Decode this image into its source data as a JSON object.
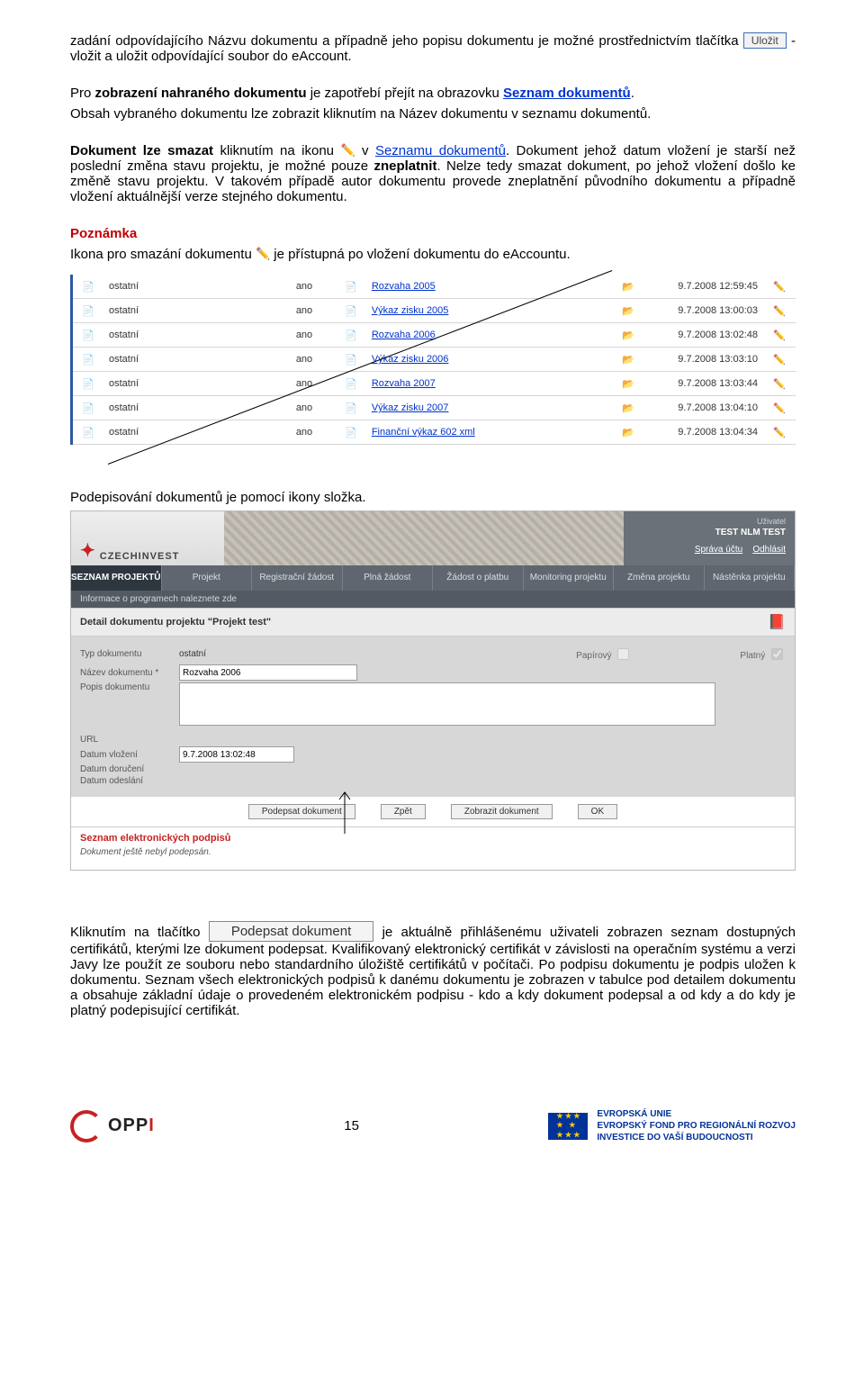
{
  "text": {
    "p1a": "zadání odpovídajícího Názvu dokumentu a případně jeho popisu dokumentu je možné prostřednictvím tlačítka ",
    "btn_ulozit": "Uložit",
    "p1b": " - vložit a uložit odpovídající soubor do eAccount.",
    "p2a": "Pro ",
    "p2b": "zobrazení nahraného dokumentu",
    "p2c": " je zapotřebí přejít na obrazovku ",
    "p2link": "Seznam dokumentů",
    "p2d": ".",
    "p3": "Obsah vybraného dokumentu lze zobrazit kliknutím na Název dokumentu v seznamu dokumentů.",
    "p4a": "Dokument lze smazat",
    "p4b": " kliknutím na ikonu ",
    "p4c": " v ",
    "p4link": "Seznamu dokumentů",
    "p4d": ". Dokument jehož datum vložení je starší než poslední změna stavu projektu, je možné pouze ",
    "p4e": "zneplatnit",
    "p4f": ". Nelze tedy smazat dokument, po jehož vložení došlo ke změně stavu projektu. V takovém případě autor dokumentu provede zneplatnění původního dokumentu a případně vložení aktuálnější verze stejného dokumentu.",
    "note_title": "Poznámka",
    "note_body_a": "Ikona pro smazání dokumentu ",
    "note_body_b": " je přístupná po vložení dokumentu do eAccountu.",
    "mid_text": "Podepisování dokumentů je pomocí ikony složka.",
    "p5a": "Kliknutím na tlačítko ",
    "btn_podepsat_long": "Podepsat dokument",
    "p5b": " je aktuálně přihlášenému uživateli zobrazen seznam dostupných certifikátů, kterými lze dokument podepsat. Kvalifikovaný elektronický certifikát v závislosti na operačním systému a verzi Javy lze použít ze souboru nebo standardního úložiště certifikátů v počítači. Po podpisu dokumentu je podpis uložen k dokumentu. Seznam všech elektronických podpisů k danému dokumentu je zobrazen v tabulce pod detailem dokumentu a obsahuje základní údaje o provedeném elektronickém podpisu - kdo a kdy dokument podepsal a od kdy a do kdy je platný podepisující certifikát.",
    "page_number": "15"
  },
  "table_rows": [
    {
      "type": "ostatní",
      "ano": "ano",
      "name": "Rozvaha 2005",
      "date": "9.7.2008 12:59:45"
    },
    {
      "type": "ostatní",
      "ano": "ano",
      "name": "Výkaz zisku 2005",
      "date": "9.7.2008 13:00:03"
    },
    {
      "type": "ostatní",
      "ano": "ano",
      "name": "Rozvaha 2006",
      "date": "9.7.2008 13:02:48"
    },
    {
      "type": "ostatní",
      "ano": "ano",
      "name": "Výkaz zisku 2006",
      "date": "9.7.2008 13:03:10"
    },
    {
      "type": "ostatní",
      "ano": "ano",
      "name": "Rozvaha 2007",
      "date": "9.7.2008 13:03:44"
    },
    {
      "type": "ostatní",
      "ano": "ano",
      "name": "Výkaz zisku 2007",
      "date": "9.7.2008 13:04:10"
    },
    {
      "type": "ostatní",
      "ano": "ano",
      "name": "Finanční výkaz 602 xml",
      "date": "9.7.2008 13:04:34"
    }
  ],
  "app": {
    "logo": "CZECHINVEST",
    "user_label": "Uživatel",
    "user_name": "TEST NLM TEST",
    "user_link1": "Správa účtu",
    "user_link2": "Odhlásit",
    "nav": [
      "SEZNAM PROJEKTŮ",
      "Projekt",
      "Registrační žádost",
      "Plná žádost",
      "Žádost o platbu",
      "Monitoring projektu",
      "Změna projektu",
      "Nástěnka projektu"
    ],
    "subnav": "Informace o programech naleznete zde",
    "panel": "Detail dokumentu projektu \"Projekt test\"",
    "form": {
      "typ_lbl": "Typ dokumentu",
      "typ_val": "ostatní",
      "nazev_lbl": "Název dokumentu *",
      "nazev_val": "Rozvaha 2006",
      "popis_lbl": "Popis dokumentu",
      "papirovy": "Papírový",
      "platny": "Platný",
      "url_lbl": "URL",
      "vlozeni_lbl": "Datum vložení",
      "vlozeni_val": "9.7.2008 13:02:48",
      "doruceni_lbl": "Datum doručení",
      "odeslani_lbl": "Datum odeslání"
    },
    "buttons": {
      "b1": "Podepsat dokument",
      "b2": "Zpět",
      "b3": "Zobrazit dokument",
      "b4": "OK"
    },
    "sig_title": "Seznam elektronických podpisů",
    "sig_note": "Dokument ještě nebyl podepsán."
  },
  "footer": {
    "oppi": "OPPI",
    "eu1": "EVROPSKÁ UNIE",
    "eu2": "EVROPSKÝ FOND PRO REGIONÁLNÍ ROZVOJ",
    "eu3": "INVESTICE DO VAŠÍ BUDOUCNOSTI"
  }
}
